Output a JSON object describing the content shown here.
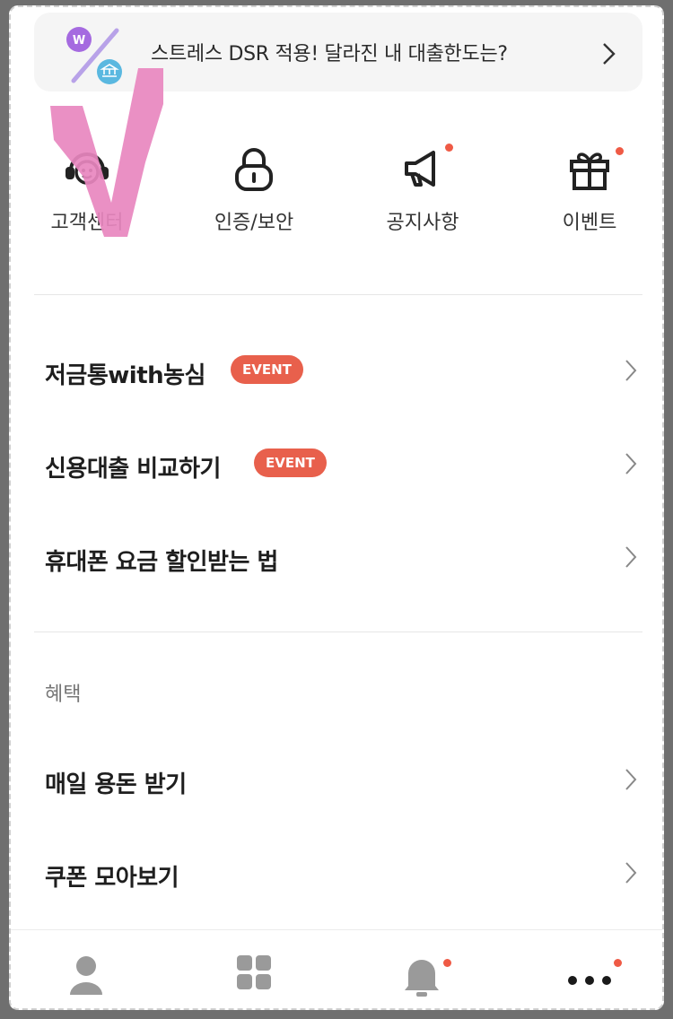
{
  "banner": {
    "text": "스트레스 DSR 적용! 달라진 내 대출한도는?",
    "icon": "percent-won-bank-icon"
  },
  "quick_menu": [
    {
      "label": "고객센터",
      "icon": "headset-icon",
      "has_dot": false
    },
    {
      "label": "인증/보안",
      "icon": "lock-icon",
      "has_dot": false
    },
    {
      "label": "공지사항",
      "icon": "megaphone-icon",
      "has_dot": true
    },
    {
      "label": "이벤트",
      "icon": "gift-icon",
      "has_dot": true
    }
  ],
  "promo_list": [
    {
      "label": "저금통with농심",
      "badge": "EVENT"
    },
    {
      "label": "신용대출 비교하기",
      "badge": "EVENT"
    },
    {
      "label": "휴대폰 요금 할인받는 법",
      "badge": ""
    }
  ],
  "benefits": {
    "title": "혜택",
    "items": [
      {
        "label": "매일 용돈 받기"
      },
      {
        "label": "쿠폰 모아보기"
      }
    ]
  },
  "tab_bar": [
    {
      "name": "profile",
      "icon": "person-icon",
      "has_dot": false
    },
    {
      "name": "menu",
      "icon": "grid-icon",
      "has_dot": false
    },
    {
      "name": "notifications",
      "icon": "bell-icon",
      "has_dot": true
    },
    {
      "name": "more",
      "icon": "more-dots-icon",
      "has_dot": true
    }
  ],
  "colors": {
    "accent": "#e8604c",
    "notification_dot": "#ef5a45",
    "annotation_mark": "#e887bf"
  }
}
